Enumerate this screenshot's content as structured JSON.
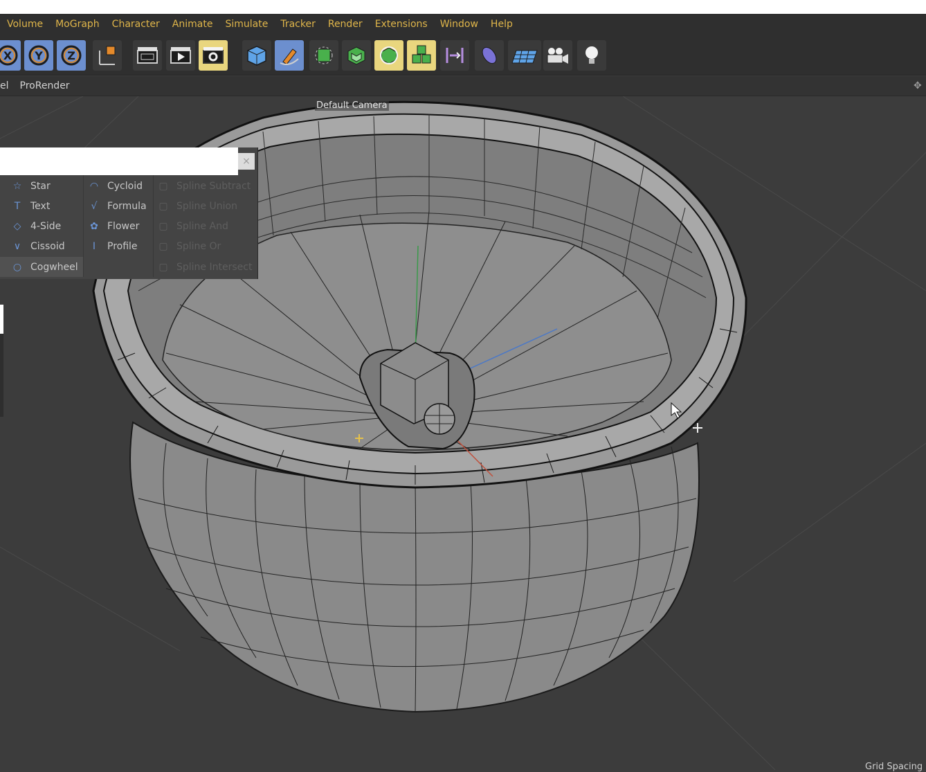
{
  "menubar": {
    "items": [
      "Volume",
      "MoGraph",
      "Character",
      "Animate",
      "Simulate",
      "Tracker",
      "Render",
      "Extensions",
      "Window",
      "Help"
    ]
  },
  "toolbar": {
    "axis_buttons": [
      "X",
      "Y",
      "Z"
    ],
    "icons": [
      "world-coordinates-icon",
      "render-view-icon",
      "render-picture-viewer-icon",
      "render-settings-icon",
      "cube-icon",
      "pen-icon",
      "subdivision-icon",
      "extrude-icon",
      "cloner-icon",
      "mograph-cubes-icon",
      "deformer-icon",
      "sweep-icon",
      "floor-icon",
      "camera-icon",
      "light-icon"
    ]
  },
  "viewbar": {
    "cut_label": "el",
    "renderer": "ProRender"
  },
  "viewport": {
    "camera_label": "Default Camera",
    "grid_label": "Grid Spacing"
  },
  "spline_menu": {
    "col1": [
      {
        "label": "Star",
        "icon": "star-icon"
      },
      {
        "label": "Text",
        "icon": "text-icon"
      },
      {
        "label": "4-Side",
        "icon": "four-side-icon"
      },
      {
        "label": "Cissoid",
        "icon": "cissoid-icon"
      },
      {
        "label": "Cogwheel",
        "icon": "cogwheel-icon"
      }
    ],
    "col2": [
      {
        "label": "Cycloid",
        "icon": "cycloid-icon"
      },
      {
        "label": "Formula",
        "icon": "formula-icon"
      },
      {
        "label": "Flower",
        "icon": "flower-icon"
      },
      {
        "label": "Profile",
        "icon": "profile-icon"
      }
    ],
    "col3": [
      {
        "label": "Spline Subtract",
        "icon": "spline-subtract-icon"
      },
      {
        "label": "Spline Union",
        "icon": "spline-union-icon"
      },
      {
        "label": "Spline And",
        "icon": "spline-and-icon"
      },
      {
        "label": "Spline Or",
        "icon": "spline-or-icon"
      },
      {
        "label": "Spline Intersect",
        "icon": "spline-intersect-icon"
      }
    ]
  },
  "colors": {
    "menu_text": "#e0b64a",
    "accent_blue": "#6c8fcf",
    "highlight_yellow": "#e9d67e",
    "viewport_bg": "#3c3c3c"
  }
}
